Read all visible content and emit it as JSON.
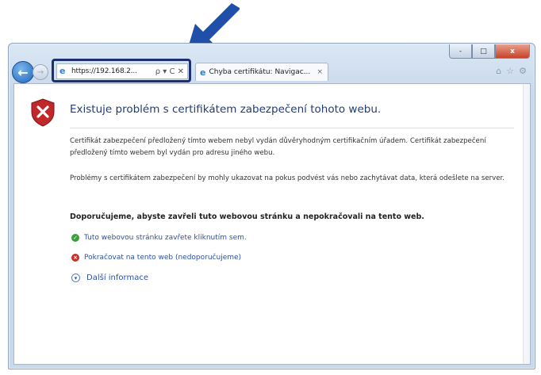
{
  "colors": {
    "arrow": "#1f4fa8",
    "highlight": "#1d2f6e",
    "link": "#2a52a6",
    "heading": "#1f3d78"
  },
  "window_controls": {
    "minimize": "-",
    "maximize": "□",
    "close": "x"
  },
  "nav": {
    "back": "←",
    "forward": "→"
  },
  "address_bar": {
    "url": "https://192.168.2...",
    "controls": "ρ ▾ C ✕"
  },
  "tab": {
    "title": "Chyba certifikátu: Navigac...",
    "close": "×"
  },
  "toolbar_icons": [
    "home-icon",
    "star-icon",
    "gear-icon"
  ],
  "page": {
    "heading": "Existuje problém s certifikátem zabezpečení tohoto webu.",
    "paragraph1": "Certifikát zabezpečení předložený tímto webem nebyl vydán důvěryhodným certifikačním úřadem. Certifikát zabezpečení předložený tímto webem byl vydán pro adresu jiného webu.",
    "paragraph2": "Problémy s certifikátem zabezpečení by mohly ukazovat na pokus podvést vás nebo zachytávat data, která odešlete na server.",
    "recommendation": "Doporučujeme, abyste zavřeli tuto webovou stránku a nepokračovali na tento web.",
    "close_link": "Tuto webovou stránku zavřete kliknutím sem.",
    "continue_link": "Pokračovat na tento web (nedoporučujeme)",
    "more_info": "Další informace"
  }
}
